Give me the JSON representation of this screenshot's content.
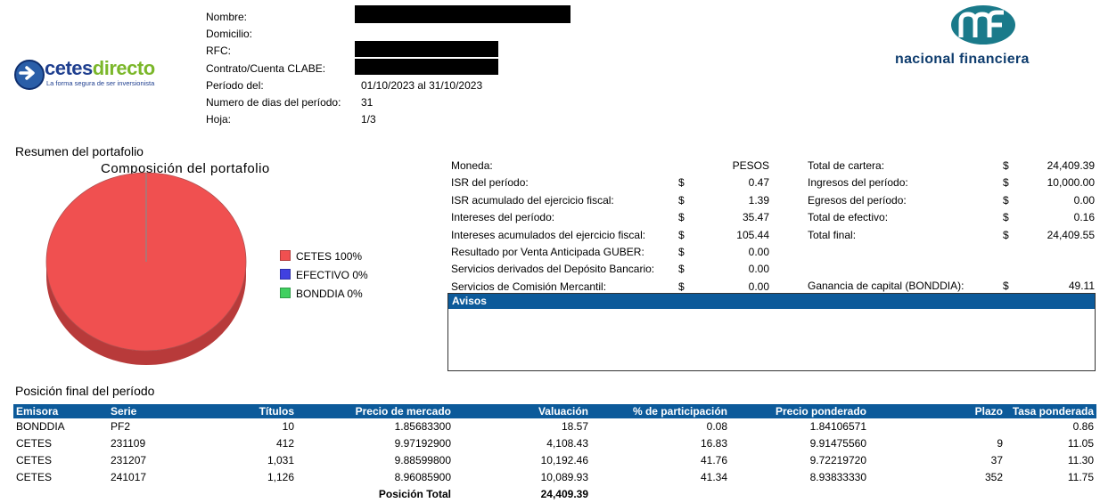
{
  "header": {
    "labels": {
      "nombre": "Nombre:",
      "domicilio": "Domicilio:",
      "rfc": "RFC:",
      "contrato": "Contrato/Cuenta CLABE:",
      "periodo": "Período del:",
      "dias": "Numero de dias del período:",
      "hoja": "Hoja:"
    },
    "values": {
      "periodo": "01/10/2023 al 31/10/2023",
      "dias": "31",
      "hoja": "1/3"
    }
  },
  "logos": {
    "cetes_part1": "cetes",
    "cetes_part2": "directo",
    "cetes_tagline": "La forma segura de ser inversionista",
    "nafin": "nacional financiera"
  },
  "portfolio": {
    "section_title": "Resumen del portafolio",
    "chart_title": "Composición del portafolio"
  },
  "chart_data": {
    "type": "pie",
    "title": "Composición del portafolio",
    "slices": [
      {
        "label": "CETES 100%",
        "value": 100,
        "color": "#f05050"
      },
      {
        "label": "EFECTIVO 0%",
        "value": 0,
        "color": "#4040e0"
      },
      {
        "label": "BONDDIA 0%",
        "value": 0,
        "color": "#40d060"
      }
    ],
    "legend_position": "right"
  },
  "summary_left": [
    {
      "label": "Moneda:",
      "currency": "",
      "value": "PESOS"
    },
    {
      "label": "ISR del período:",
      "currency": "$",
      "value": "0.47"
    },
    {
      "label": "ISR acumulado del ejercicio fiscal:",
      "currency": "$",
      "value": "1.39"
    },
    {
      "label": "Intereses del período:",
      "currency": "$",
      "value": "35.47"
    },
    {
      "label": "Intereses acumulados del ejercicio fiscal:",
      "currency": "$",
      "value": "105.44"
    },
    {
      "label": "Resultado por Venta Anticipada GUBER:",
      "currency": "$",
      "value": "0.00"
    },
    {
      "label": "Servicios derivados del Depósito Bancario:",
      "currency": "$",
      "value": "0.00"
    },
    {
      "label": "Servicios de Comisión Mercantil:",
      "currency": "$",
      "value": "0.00"
    }
  ],
  "summary_right": [
    {
      "label": "Total de cartera:",
      "currency": "$",
      "value": "24,409.39"
    },
    {
      "label": "Ingresos del período:",
      "currency": "$",
      "value": "10,000.00"
    },
    {
      "label": "Egresos del período:",
      "currency": "$",
      "value": "0.00"
    },
    {
      "label": "Total de efectivo:",
      "currency": "$",
      "value": "0.16"
    },
    {
      "label": "Total final:",
      "currency": "$",
      "value": "24,409.55"
    }
  ],
  "ganancia": {
    "label": "Ganancia de capital (BONDDIA):",
    "currency": "$",
    "value": "49.11"
  },
  "avisos": {
    "title": "Avisos"
  },
  "positions": {
    "section_title": "Posición final del período",
    "columns": [
      "Emisora",
      "Serie",
      "Títulos",
      "Precio de mercado",
      "Valuación",
      "% de participación",
      "Precio ponderado",
      "Plazo",
      "Tasa ponderada"
    ],
    "rows": [
      [
        "BONDDIA",
        "PF2",
        "10",
        "1.85683300",
        "18.57",
        "0.08",
        "1.84106571",
        "",
        "0.86"
      ],
      [
        "CETES",
        "231109",
        "412",
        "9.97192900",
        "4,108.43",
        "16.83",
        "9.91475560",
        "9",
        "11.05"
      ],
      [
        "CETES",
        "231207",
        "1,031",
        "9.88599800",
        "10,192.46",
        "41.76",
        "9.72219720",
        "37",
        "11.30"
      ],
      [
        "CETES",
        "241017",
        "1,126",
        "8.96085900",
        "10,089.93",
        "41.34",
        "8.93833330",
        "352",
        "11.75"
      ]
    ],
    "total_label": "Posición Total",
    "total_value": "24,409.39"
  }
}
